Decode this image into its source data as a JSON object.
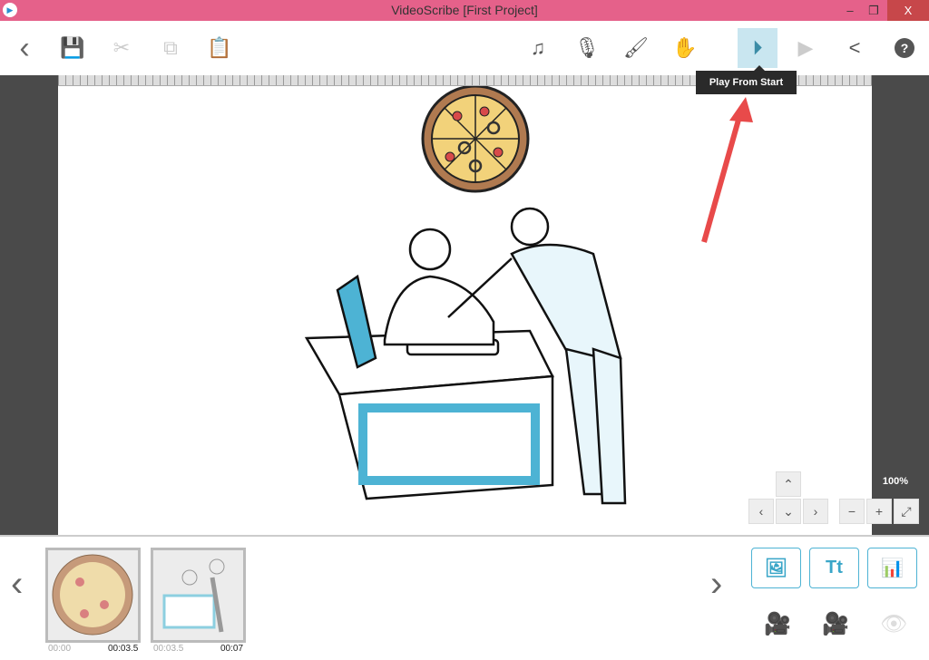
{
  "window": {
    "title": "VideoScribe [First Project]",
    "minimize": "–",
    "restore": "❐",
    "close": "X"
  },
  "toolbar": {
    "back": "‹",
    "save": "💾",
    "cut": "✂",
    "copy": "⧉",
    "paste": "📋",
    "music": "♫",
    "mic": "🎙",
    "brush": "🖌",
    "hand": "✋",
    "play_from_start": "⏵",
    "play": "▶",
    "share": "<",
    "help": "?"
  },
  "tooltip": "Play From Start",
  "canvas_nav": {
    "up": "⌃",
    "left": "‹",
    "down": "⌄",
    "right": "›",
    "zoom_out": "−",
    "zoom_in": "+",
    "fit": "⤢",
    "zoom_level": "100%"
  },
  "timeline": {
    "prev": "‹",
    "next": "›",
    "elements": [
      {
        "name": "pizza",
        "start": "00:00",
        "end": "00:03.5"
      },
      {
        "name": "office workers",
        "start": "00:03.5",
        "end": "00:07"
      }
    ]
  },
  "add_buttons": {
    "image": "🖼",
    "text": "Tt",
    "chart": "📊"
  },
  "colors": {
    "titlebar": "#e5618a",
    "accent": "#4db3d4",
    "arrow": "#e84a4a"
  }
}
